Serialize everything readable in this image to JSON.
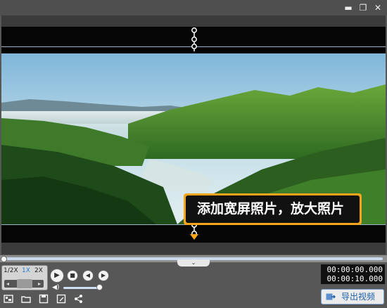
{
  "window": {
    "minimize_icon": "minimize-icon",
    "restore_icon": "restore-icon",
    "close_icon": "close-icon"
  },
  "preview": {
    "tip_text": "添加宽屏照片，放大照片"
  },
  "playback": {
    "speeds": [
      "1/2X",
      "1X",
      "2X"
    ],
    "active_speed": "1X",
    "volume_level": 0.9,
    "current_time": "00:00:00.000",
    "total_time": "00:00:10.000"
  },
  "toolbar": {
    "export_label": "导出视频"
  }
}
